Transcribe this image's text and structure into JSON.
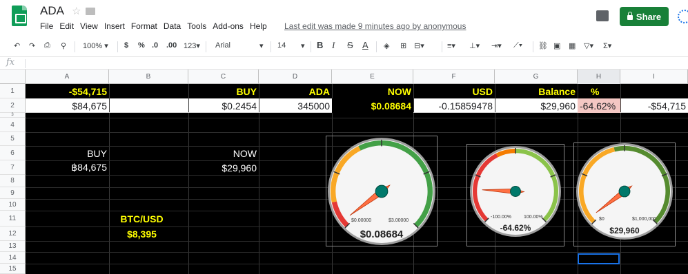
{
  "app": {
    "doc_title": "ADA",
    "last_edit": "Last edit was made 9 minutes ago by anonymous",
    "share_label": "Share"
  },
  "menu": [
    "File",
    "Edit",
    "View",
    "Insert",
    "Format",
    "Data",
    "Tools",
    "Add-ons",
    "Help"
  ],
  "toolbar": {
    "zoom": "100%",
    "currency": "$",
    "percent": "%",
    "dec_less": ".0",
    "dec_more": ".00",
    "more_formats": "123",
    "font": "Arial",
    "font_size": "14",
    "bold": "B",
    "italic": "I",
    "strike": "S",
    "text_color": "A"
  },
  "formula": {
    "fx_label": "fx"
  },
  "columns": [
    "A",
    "B",
    "C",
    "D",
    "E",
    "F",
    "G",
    "H",
    "I"
  ],
  "rows": [
    "1",
    "2",
    "3",
    "4",
    "5",
    "6",
    "7",
    "8",
    "9",
    "10",
    "11",
    "12",
    "13",
    "14",
    "15"
  ],
  "row1": {
    "a": "-$54,715",
    "c": "BUY",
    "d": "ADA",
    "e": "NOW",
    "f": "USD",
    "g": "Balance",
    "h": "%"
  },
  "row2": {
    "a": "$84,675",
    "c": "$0.2454",
    "d": "345000",
    "e": "$0.08684",
    "f": "-0.15859478",
    "g": "$29,960",
    "h": "-64.62%",
    "i": "-$54,715"
  },
  "labels": {
    "buy_label": "BUY",
    "buy_value": "฿84,675",
    "now_label": "NOW",
    "now_value": "$29,960",
    "btc_label": "BTC/USD",
    "btc_value": "$8,395"
  },
  "gauges": [
    {
      "name": "price",
      "min_label": "$0.00000",
      "max_label": "$3.00000",
      "value_label": "$0.08684",
      "value": 0.08684,
      "min": 0,
      "max": 3
    },
    {
      "name": "percent",
      "min_label": "-100.00%",
      "max_label": "100.00%",
      "value_label": "-64.62%",
      "value": -64.62,
      "min": -100,
      "max": 100
    },
    {
      "name": "balance",
      "min_label": "$0",
      "max_label": "$1,000,000",
      "value_label": "$29,960",
      "value": 29960,
      "min": 0,
      "max": 1000000
    }
  ],
  "colors": {
    "header_bg": "#000000",
    "header_text": "#ffff00",
    "share_green": "#188038",
    "neg_pct_bg": "#f4c7c3"
  }
}
